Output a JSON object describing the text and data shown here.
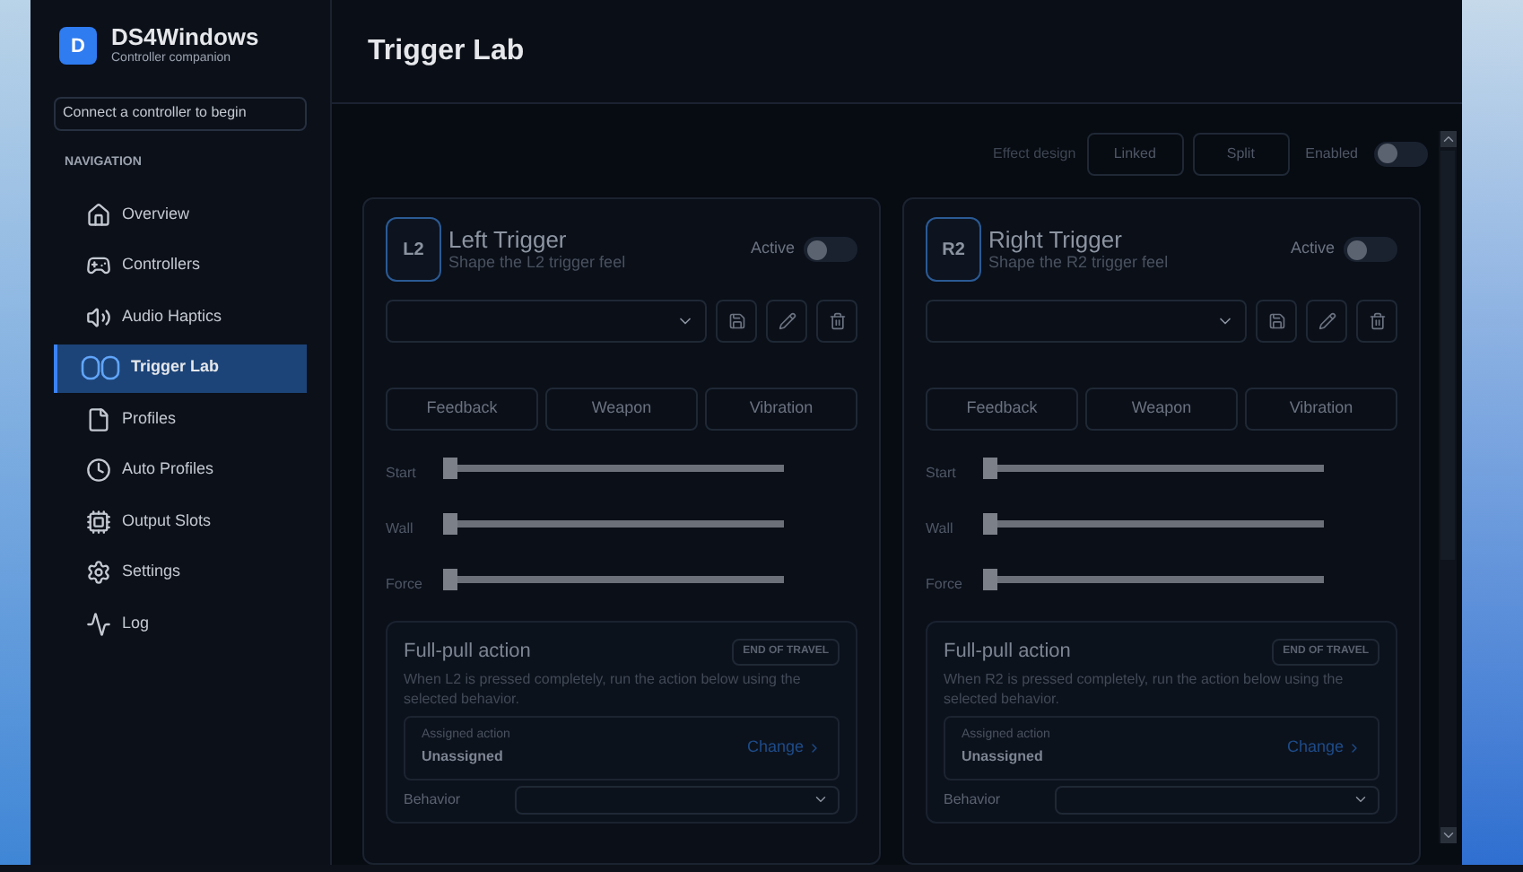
{
  "app": {
    "name": "DS4Windows",
    "subtitle": "Controller companion",
    "logo_letter": "D"
  },
  "status_text": "Connect a controller to begin",
  "nav": {
    "heading": "NAVIGATION",
    "items": [
      {
        "label": "Overview",
        "selected": false
      },
      {
        "label": "Controllers",
        "selected": false
      },
      {
        "label": "Audio Haptics",
        "selected": false
      },
      {
        "label": "Trigger Lab",
        "selected": true
      },
      {
        "label": "Profiles",
        "selected": false
      },
      {
        "label": "Auto Profiles",
        "selected": false
      },
      {
        "label": "Output Slots",
        "selected": false
      },
      {
        "label": "Settings",
        "selected": false
      },
      {
        "label": "Log",
        "selected": false
      }
    ]
  },
  "page_title": "Trigger Lab",
  "effect_design": {
    "label": "Effect design",
    "options": [
      {
        "label": "Linked",
        "selected": false
      },
      {
        "label": "Split",
        "selected": false
      }
    ],
    "enabled": {
      "label": "Enabled",
      "on": false
    }
  },
  "triggers": [
    {
      "badge": "L2",
      "title": "Left Trigger",
      "subtitle": "Shape the L2 trigger feel",
      "active": {
        "label": "Active",
        "on": false
      },
      "tabs": [
        {
          "label": "Feedback",
          "selected": false
        },
        {
          "label": "Weapon",
          "selected": false
        },
        {
          "label": "Vibration",
          "selected": false
        }
      ],
      "sliders": [
        {
          "label": "Start",
          "level": 0
        },
        {
          "label": "Wall",
          "level": 0
        },
        {
          "label": "Force",
          "level": 0
        }
      ],
      "full_pull": {
        "title": "Full-pull action",
        "badge": "END OF TRAVEL",
        "description": "When L2 is pressed completely, run the action below using the selected behavior.",
        "assigned_label": "Assigned action",
        "assigned_value": "Unassigned",
        "change": "Change",
        "behavior_label": "Behavior"
      }
    },
    {
      "badge": "R2",
      "title": "Right Trigger",
      "subtitle": "Shape the R2 trigger feel",
      "active": {
        "label": "Active",
        "on": false
      },
      "tabs": [
        {
          "label": "Feedback",
          "selected": false
        },
        {
          "label": "Weapon",
          "selected": false
        },
        {
          "label": "Vibration",
          "selected": false
        }
      ],
      "sliders": [
        {
          "label": "Start",
          "level": 0
        },
        {
          "label": "Wall",
          "level": 0
        },
        {
          "label": "Force",
          "level": 0
        }
      ],
      "full_pull": {
        "title": "Full-pull action",
        "badge": "END OF TRAVEL",
        "description": "When R2 is pressed completely, run the action below using the selected behavior.",
        "assigned_label": "Assigned action",
        "assigned_value": "Unassigned",
        "change": "Change",
        "behavior_label": "Behavior"
      }
    }
  ]
}
